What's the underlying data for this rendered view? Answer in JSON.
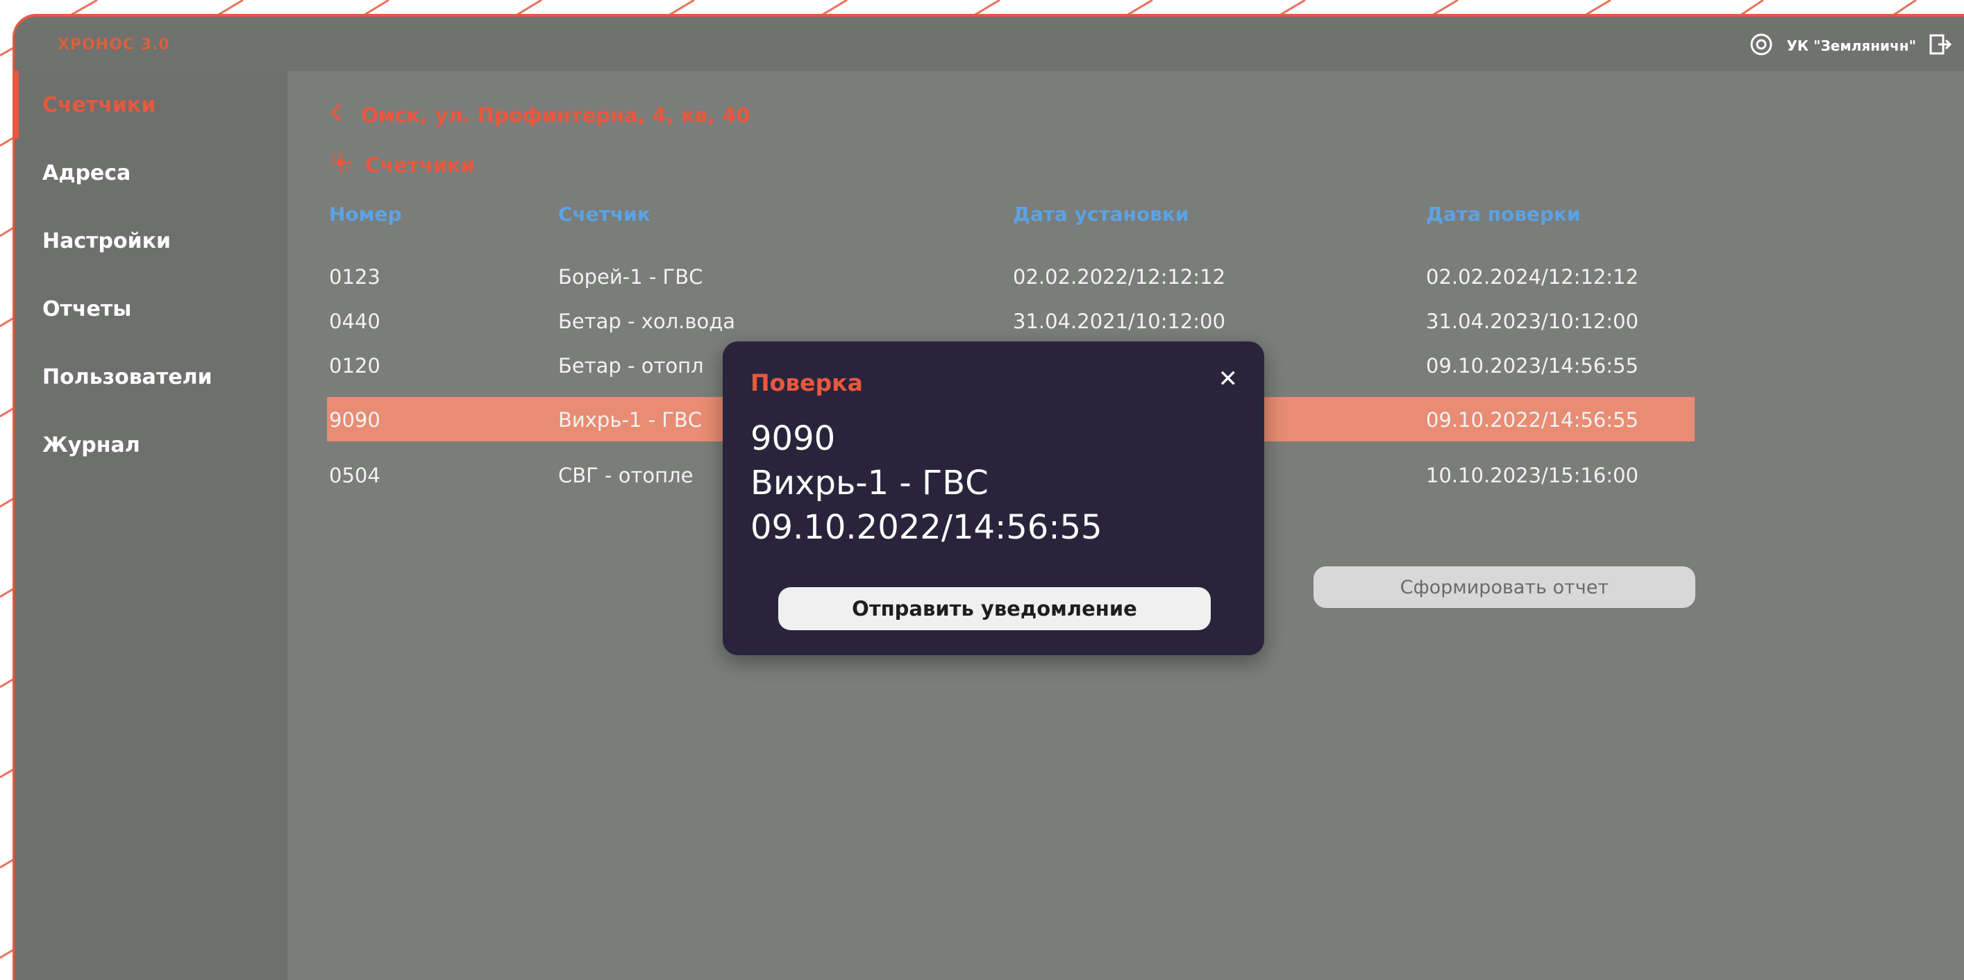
{
  "app": {
    "title": "ХРОНОС 3.0",
    "company": "УК \"Земляничн\""
  },
  "sidebar": {
    "items": [
      {
        "label": "Счетчики",
        "active": true
      },
      {
        "label": "Адреса"
      },
      {
        "label": "Настройки"
      },
      {
        "label": "Отчеты"
      },
      {
        "label": "Пользователи"
      },
      {
        "label": "Журнал"
      }
    ]
  },
  "breadcrumb": {
    "back_icon": "chevron-left-icon",
    "address": "Омск, ул. Профинтерна, 4, кв, 40"
  },
  "section": {
    "icon": "meter-icon",
    "title": "Счетчики"
  },
  "table": {
    "headers": [
      "Номер",
      "Счетчик",
      "Дата установки",
      "Дата поверки"
    ],
    "rows": [
      {
        "number": "0123",
        "meter": "Борей-1 - ГВС",
        "installed": "02.02.2022/12:12:12",
        "verified": "02.02.2024/12:12:12"
      },
      {
        "number": "0440",
        "meter": "Бетар - хол.вода",
        "installed": "31.04.2021/10:12:00",
        "verified": "31.04.2023/10:12:00"
      },
      {
        "number": "0120",
        "meter": "Бетар - отопл",
        "installed": "",
        "verified": "09.10.2023/14:56:55"
      },
      {
        "number": "9090",
        "meter": "Вихрь-1 - ГВС",
        "installed": "",
        "verified": "09.10.2022/14:56:55",
        "selected": true
      },
      {
        "number": "0504",
        "meter": "СВГ - отопле",
        "installed": "",
        "verified": "10.10.2023/15:16:00"
      }
    ]
  },
  "actions": {
    "report_label": "Сформировать отчет"
  },
  "modal": {
    "title": "Поверка",
    "close_icon": "close-icon",
    "number": "9090",
    "meter": "Вихрь-1 - ГВС",
    "date": "09.10.2022/14:56:55",
    "notify_label": "Отправить уведомление"
  },
  "colors": {
    "accent": "#e8583f",
    "header_blue": "#5ba3e4",
    "selected_row": "#e88c73",
    "modal_bg": "#29243b",
    "panel_bg": "#7a7d79"
  }
}
